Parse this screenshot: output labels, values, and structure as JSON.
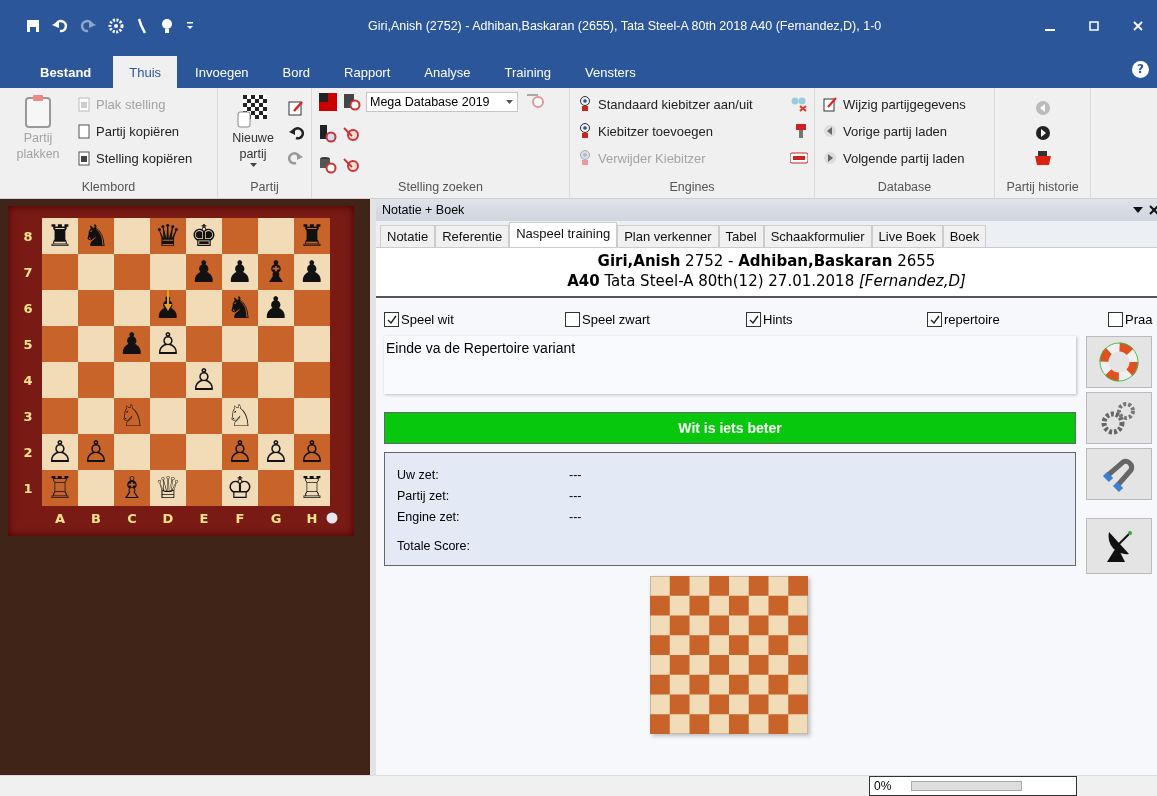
{
  "window": {
    "title": "Giri,Anish (2752) - Adhiban,Baskaran (2655), Tata Steel-A 80th 2018  A40  (Fernandez,D), 1-0"
  },
  "ribbon_tabs": [
    {
      "label": "Bestand",
      "selected": false,
      "kind": "file"
    },
    {
      "label": "Thuis",
      "selected": true,
      "kind": "tab"
    },
    {
      "label": "Invoegen",
      "selected": false,
      "kind": "tab"
    },
    {
      "label": "Bord",
      "selected": false,
      "kind": "tab"
    },
    {
      "label": "Rapport",
      "selected": false,
      "kind": "tab"
    },
    {
      "label": "Analyse",
      "selected": false,
      "kind": "tab"
    },
    {
      "label": "Training",
      "selected": false,
      "kind": "tab"
    },
    {
      "label": "Vensters",
      "selected": false,
      "kind": "tab"
    }
  ],
  "ribbon": {
    "klembord": {
      "label": "Klembord",
      "items": [
        {
          "label": "Partij plakken",
          "disabled": true
        },
        {
          "label": "Plak stelling",
          "disabled": true
        },
        {
          "label": "Partij kopiëren",
          "disabled": false
        },
        {
          "label": "Stelling kopiëren",
          "disabled": false
        }
      ]
    },
    "partij": {
      "label": "Partij",
      "new_game": "Nieuwe partij"
    },
    "stelling_zoeken": {
      "label": "Stelling zoeken",
      "database": "Mega Database 2019"
    },
    "engines": {
      "label": "Engines",
      "items": [
        {
          "label": "Standaard kiebitzer aan/uit",
          "disabled": false
        },
        {
          "label": "Kiebitzer toevoegen",
          "disabled": false
        },
        {
          "label": "Verwijder Kiebitzer",
          "disabled": true
        }
      ]
    },
    "database": {
      "label": "Database",
      "items": [
        {
          "label": "Wijzig partijgegevens",
          "disabled": false
        },
        {
          "label": "Vorige partij laden",
          "disabled": false
        },
        {
          "label": "Volgende partij laden",
          "disabled": false
        }
      ]
    },
    "historie": {
      "label": "Partij historie"
    }
  },
  "board": {
    "files": [
      "A",
      "B",
      "C",
      "D",
      "E",
      "F",
      "G",
      "H"
    ],
    "ranks": [
      "8",
      "7",
      "6",
      "5",
      "4",
      "3",
      "2",
      "1"
    ],
    "rows": [
      [
        {
          "kind": "piece",
          "glyph": "♜"
        },
        {
          "kind": "piece",
          "glyph": "♞"
        },
        {
          "kind": "empty"
        },
        {
          "kind": "piece",
          "glyph": "♛"
        },
        {
          "kind": "piece",
          "glyph": "♚"
        },
        {
          "kind": "empty"
        },
        {
          "kind": "empty"
        },
        {
          "kind": "piece",
          "glyph": "♜"
        }
      ],
      [
        {
          "kind": "empty"
        },
        {
          "kind": "empty"
        },
        {
          "kind": "empty"
        },
        {
          "kind": "empty"
        },
        {
          "kind": "piece",
          "glyph": "♟"
        },
        {
          "kind": "piece",
          "glyph": "♟"
        },
        {
          "kind": "piece",
          "glyph": "♝"
        },
        {
          "kind": "piece",
          "glyph": "♟"
        }
      ],
      [
        {
          "kind": "empty"
        },
        {
          "kind": "empty"
        },
        {
          "kind": "empty"
        },
        {
          "kind": "piece",
          "glyph": "♟",
          "last_move": true
        },
        {
          "kind": "empty"
        },
        {
          "kind": "piece",
          "glyph": "♞"
        },
        {
          "kind": "piece",
          "glyph": "♟"
        },
        {
          "kind": "empty"
        }
      ],
      [
        {
          "kind": "empty"
        },
        {
          "kind": "empty"
        },
        {
          "kind": "piece",
          "glyph": "♟"
        },
        {
          "kind": "piece",
          "glyph": "♙"
        },
        {
          "kind": "empty"
        },
        {
          "kind": "empty"
        },
        {
          "kind": "empty"
        },
        {
          "kind": "empty"
        }
      ],
      [
        {
          "kind": "empty"
        },
        {
          "kind": "empty"
        },
        {
          "kind": "empty"
        },
        {
          "kind": "empty"
        },
        {
          "kind": "piece",
          "glyph": "♙"
        },
        {
          "kind": "empty"
        },
        {
          "kind": "empty"
        },
        {
          "kind": "empty"
        }
      ],
      [
        {
          "kind": "empty"
        },
        {
          "kind": "empty"
        },
        {
          "kind": "piece",
          "glyph": "♘"
        },
        {
          "kind": "empty"
        },
        {
          "kind": "empty"
        },
        {
          "kind": "piece",
          "glyph": "♘"
        },
        {
          "kind": "empty"
        },
        {
          "kind": "empty"
        }
      ],
      [
        {
          "kind": "piece",
          "glyph": "♙"
        },
        {
          "kind": "piece",
          "glyph": "♙"
        },
        {
          "kind": "empty"
        },
        {
          "kind": "empty"
        },
        {
          "kind": "empty"
        },
        {
          "kind": "piece",
          "glyph": "♙"
        },
        {
          "kind": "piece",
          "glyph": "♙"
        },
        {
          "kind": "piece",
          "glyph": "♙"
        }
      ],
      [
        {
          "kind": "piece",
          "glyph": "♖"
        },
        {
          "kind": "empty"
        },
        {
          "kind": "piece",
          "glyph": "♗"
        },
        {
          "kind": "piece",
          "glyph": "♕"
        },
        {
          "kind": "empty"
        },
        {
          "kind": "piece",
          "glyph": "♔"
        },
        {
          "kind": "empty"
        },
        {
          "kind": "piece",
          "glyph": "♖"
        }
      ]
    ]
  },
  "panel": {
    "title": "Notatie + Boek",
    "tabs": [
      {
        "label": "Notatie",
        "selected": false
      },
      {
        "label": "Referentie",
        "selected": false
      },
      {
        "label": "Naspeel training",
        "selected": true
      },
      {
        "label": "Plan verkenner",
        "selected": false
      },
      {
        "label": "Tabel",
        "selected": false
      },
      {
        "label": "Schaakformulier",
        "selected": false
      },
      {
        "label": "Live Boek",
        "selected": false
      },
      {
        "label": "Boek",
        "selected": false
      }
    ],
    "game_header": [
      "**Giri,Anish** 2752 - **Adhiban,Baskaran** 2655",
      "**A40** Tata Steel-A 80th(12) 27.01.2018 *[Fernandez,D]*"
    ],
    "options": [
      {
        "label": "Speel wit",
        "checked": true
      },
      {
        "label": "Speel zwart",
        "checked": false
      },
      {
        "label": "Hints",
        "checked": true
      },
      {
        "label": "repertoire",
        "checked": true
      },
      {
        "label": "Praa",
        "checked": false
      }
    ],
    "message": "Einde va de Repertoire variant",
    "evaluation": "Wit is iets beter",
    "scores": [
      {
        "label": "Uw zet:",
        "value": "---"
      },
      {
        "label": "Partij zet:",
        "value": "---"
      },
      {
        "label": "Engine zet:",
        "value": "---"
      },
      {
        "label": "Totale Score:"
      }
    ]
  },
  "help": "?",
  "status_bar": {
    "progress": {
      "text": "0%",
      "level": 0
    }
  }
}
